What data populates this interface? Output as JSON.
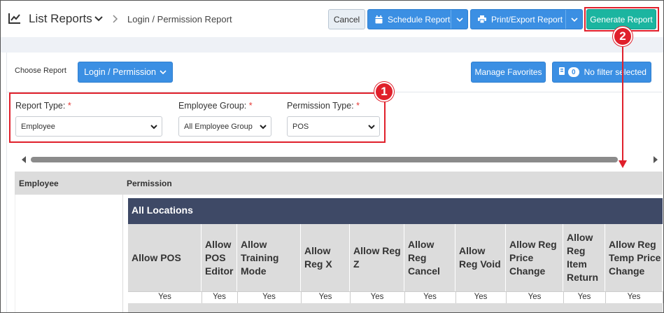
{
  "header": {
    "title": "List Reports",
    "breadcrumb": "Login / Permission Report",
    "cancel_label": "Cancel",
    "schedule_label": "Schedule Report",
    "print_label": "Print/Export Report",
    "generate_label": "Generate Report"
  },
  "controls": {
    "choose_label": "Choose Report",
    "choose_value": "Login / Permission",
    "favorites_label": "Manage Favorites",
    "filter_count": "0",
    "filter_label": "No filter selected"
  },
  "filters": {
    "report_type": {
      "label": "Report Type:",
      "required": "*",
      "value": "Employee"
    },
    "employee_group": {
      "label": "Employee Group:",
      "required": "*",
      "value": "All Employee Group"
    },
    "permission_type": {
      "label": "Permission Type:",
      "required": "*",
      "value": "POS"
    }
  },
  "callouts": {
    "one": "1",
    "two": "2"
  },
  "table": {
    "col_employee": "Employee",
    "col_permission": "Permission",
    "location": "All Locations",
    "perm_columns": [
      {
        "label": "Allow POS",
        "value": "Yes"
      },
      {
        "label": "Allow POS Editor",
        "value": "Yes"
      },
      {
        "label": "Allow Training Mode",
        "value": "Yes"
      },
      {
        "label": "Allow Reg X",
        "value": "Yes"
      },
      {
        "label": "Allow Reg Z",
        "value": "Yes"
      },
      {
        "label": "Allow Reg Cancel",
        "value": "Yes"
      },
      {
        "label": "Allow Reg Void",
        "value": "Yes"
      },
      {
        "label": "Allow Reg Price Change",
        "value": "Yes"
      },
      {
        "label": "Allow Reg Item Return",
        "value": "Yes"
      },
      {
        "label": "Allow Reg Temp Price Change",
        "value": "Yes"
      }
    ]
  },
  "colors": {
    "accent": "#3b8fe3",
    "generate": "#1bb5a0",
    "annotation": "#e0202b",
    "location_header": "#3e4966"
  }
}
